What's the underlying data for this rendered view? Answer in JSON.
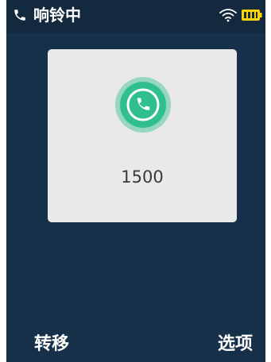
{
  "status_bar": {
    "title": "响铃中",
    "icons": [
      "phone-icon",
      "wifi-icon",
      "battery-icon"
    ],
    "accent_color": "#ffd400"
  },
  "call": {
    "number": "1500",
    "icon": "ringing-phone-icon",
    "icon_color": "#2fc08e"
  },
  "softkeys": {
    "left_label": "转移",
    "right_label": "选项"
  },
  "colors": {
    "screen_background": "#153048",
    "card_background": "#e9e9ea"
  }
}
